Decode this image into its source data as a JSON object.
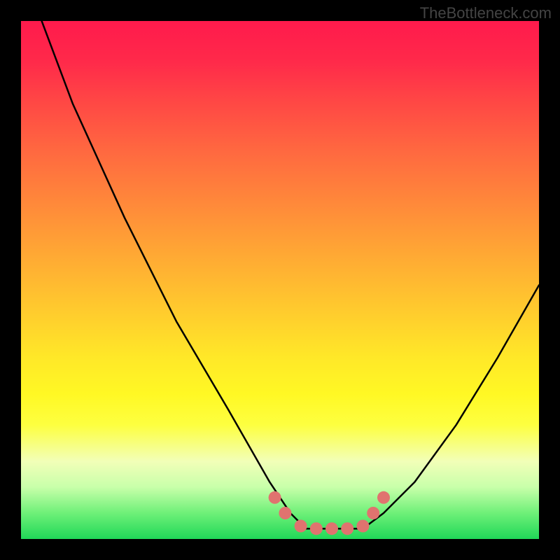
{
  "watermark": "TheBottleneck.com",
  "chart_data": {
    "type": "line",
    "title": "",
    "xlabel": "",
    "ylabel": "",
    "xlim": [
      0,
      100
    ],
    "ylim": [
      0,
      100
    ],
    "note": "V-shaped bottleneck curve over a red-to-green vertical gradient; minimum (flat segment) near x≈55–66 at y≈2; left arm rises steeply to y≈100 near x≈4; right arm rises to y≈49 at x=100.",
    "series": [
      {
        "name": "bottleneck-curve",
        "x": [
          4,
          10,
          20,
          30,
          40,
          48,
          52,
          55,
          58,
          62,
          66,
          70,
          76,
          84,
          92,
          100
        ],
        "y": [
          100,
          84,
          62,
          42,
          25,
          11,
          5,
          2,
          2,
          2,
          2,
          5,
          11,
          22,
          35,
          49
        ]
      }
    ],
    "markers": {
      "name": "highlight-dots",
      "color": "#e0736f",
      "points": [
        {
          "x": 49,
          "y": 8
        },
        {
          "x": 51,
          "y": 5
        },
        {
          "x": 54,
          "y": 2.5
        },
        {
          "x": 57,
          "y": 2
        },
        {
          "x": 60,
          "y": 2
        },
        {
          "x": 63,
          "y": 2
        },
        {
          "x": 66,
          "y": 2.5
        },
        {
          "x": 68,
          "y": 5
        },
        {
          "x": 70,
          "y": 8
        }
      ]
    },
    "gradient_stops": [
      {
        "pos": 0,
        "color": "#ff1a4c"
      },
      {
        "pos": 50,
        "color": "#ffe030"
      },
      {
        "pos": 100,
        "color": "#20d858"
      }
    ]
  }
}
